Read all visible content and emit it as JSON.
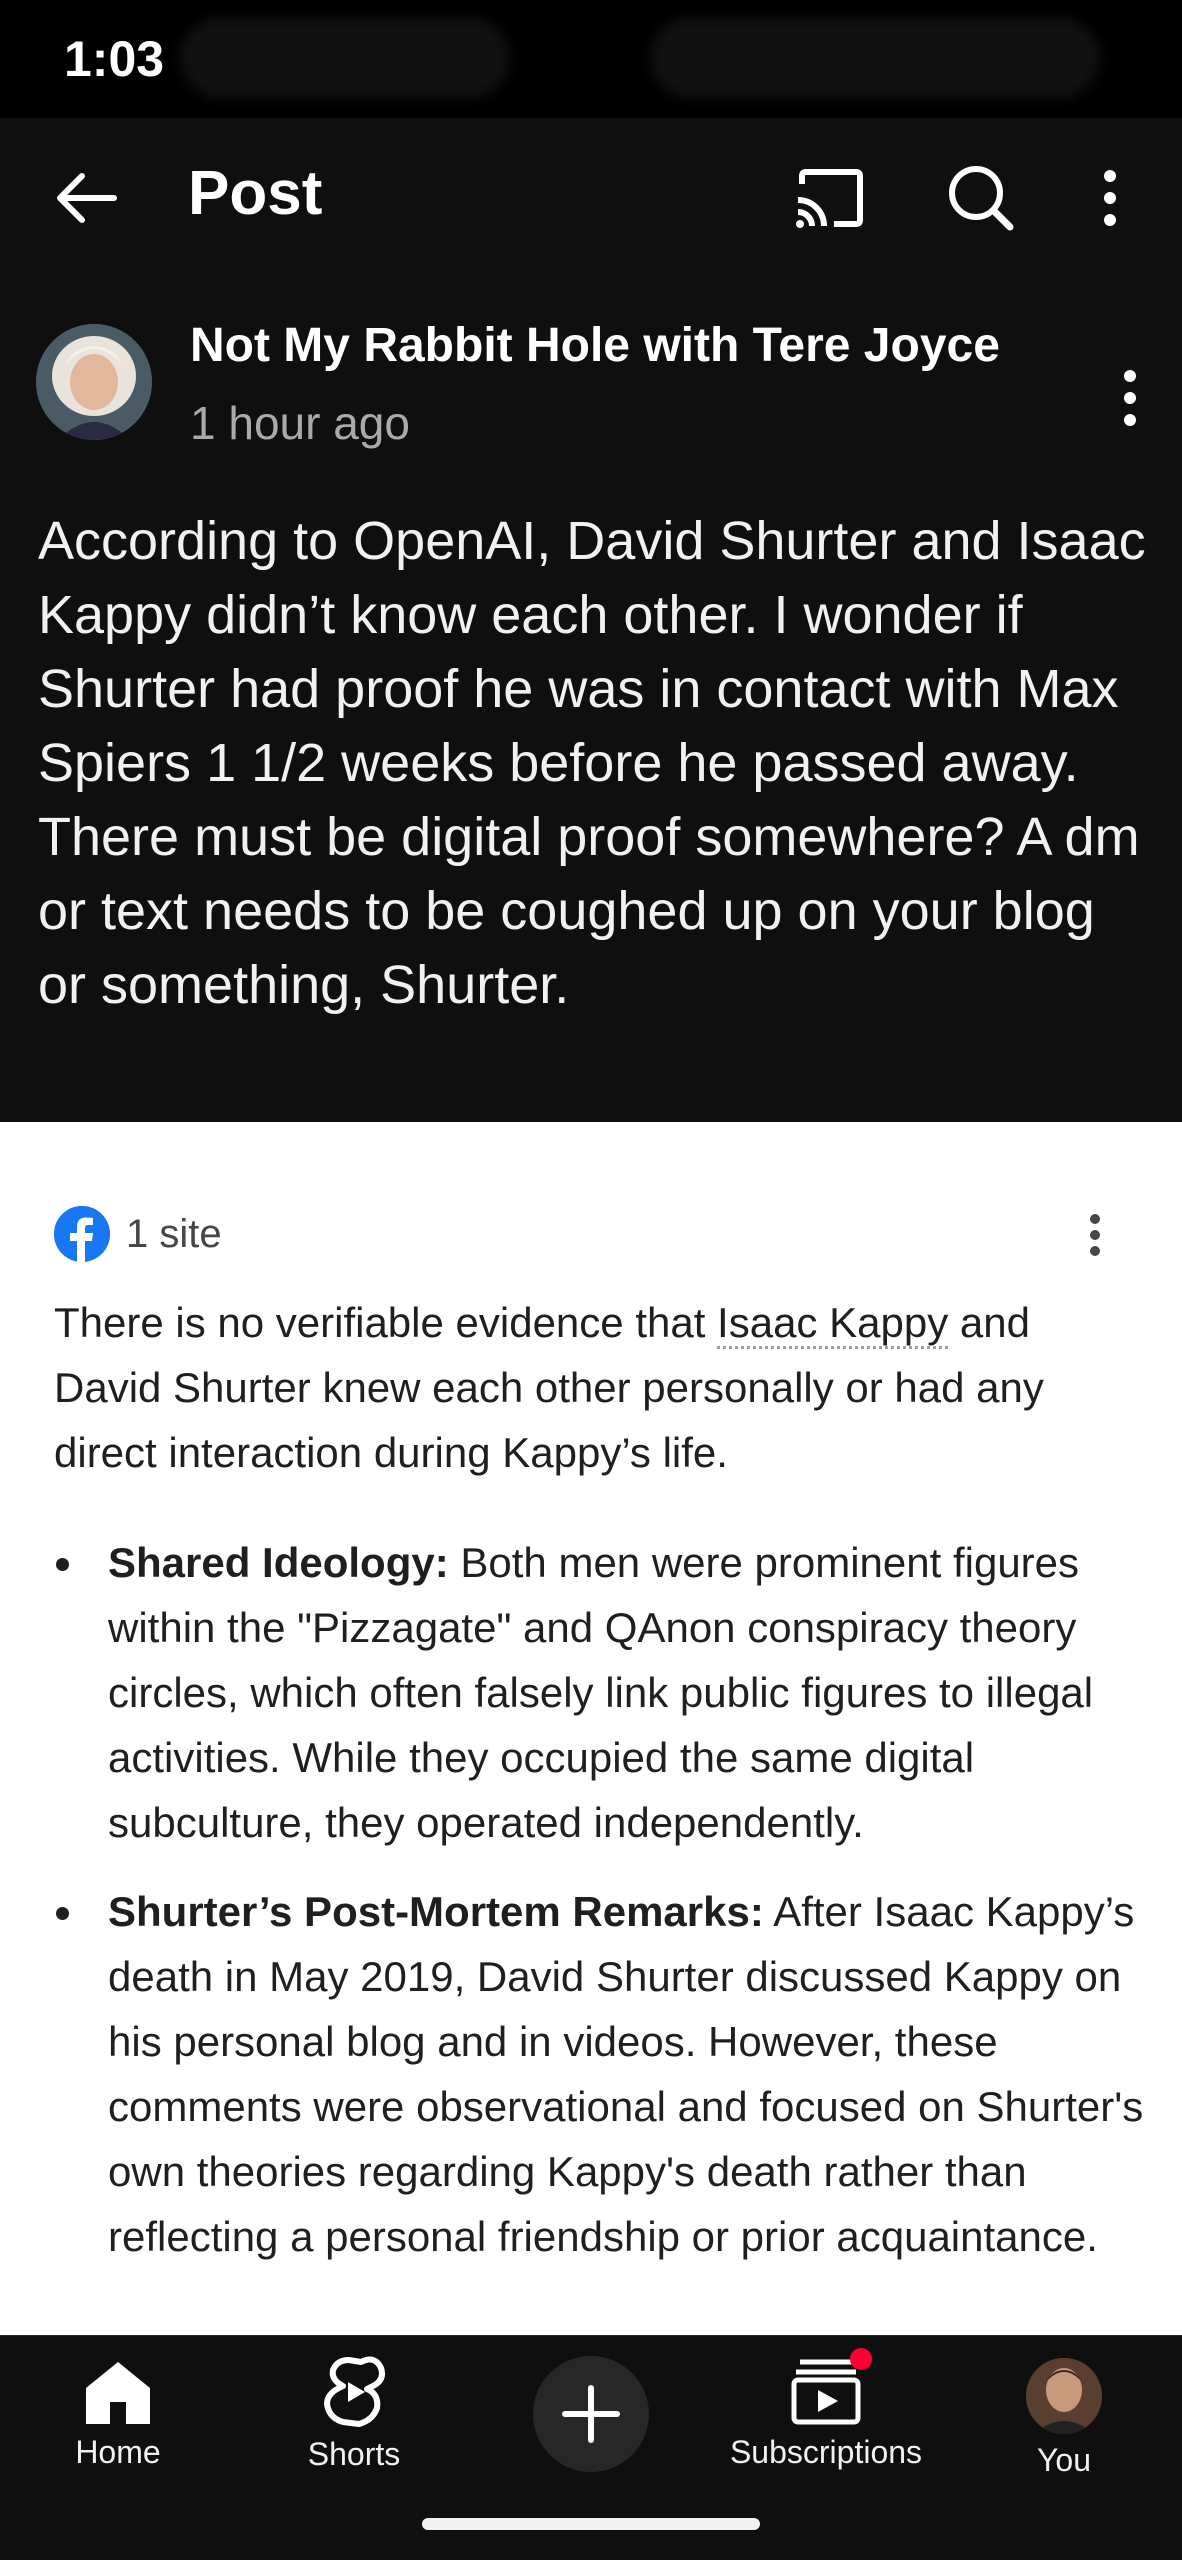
{
  "status_bar": {
    "time": "1:03"
  },
  "app_bar": {
    "title": "Post",
    "back_icon": "arrow-left-icon",
    "cast_icon": "cast-icon",
    "search_icon": "search-icon",
    "more_icon": "more-vertical-icon"
  },
  "post": {
    "channel_name": "Not My Rabbit Hole with Tere Joyce",
    "time_ago": "1 hour ago",
    "text": "According to OpenAI, David Shurter and Isaac Kappy didn’t know each other. I wonder if Shurter had proof he was in contact with Max Spiers 1 1/2 weeks before he passed away. There must be digital proof somewhere? A dm or text needs to be coughed up on your blog or something, Shurter."
  },
  "ai_card": {
    "source_icon": "facebook-icon",
    "source_label": "1 site",
    "summary_pre": "There is no verifiable evidence that ",
    "summary_link": "Isaac Kappy",
    "summary_post": " and David Shurter knew each other personally or had any direct interaction during Kappy’s life.",
    "bullets": [
      {
        "heading": "Shared Ideology:",
        "body": " Both men were prominent figures within the \"Pizzagate\" and QAnon conspiracy theory circles, which often falsely link public figures to illegal activities. While they occupied the same digital subculture, they operated independently."
      },
      {
        "heading": "Shurter’s Post-Mortem Remarks:",
        "body": " After Isaac Kappy’s death in May 2019, David Shurter discussed Kappy on his personal blog and in videos. However, these comments were observational and focused on Shurter's own theories regarding Kappy's death rather than reflecting a personal friendship or prior acquaintance."
      }
    ]
  },
  "bottom_nav": {
    "items": [
      {
        "label": "Home",
        "icon": "home-icon"
      },
      {
        "label": "Shorts",
        "icon": "shorts-icon"
      },
      {
        "label": "",
        "icon": "plus-icon"
      },
      {
        "label": "Subscriptions",
        "icon": "subscriptions-icon"
      },
      {
        "label": "You",
        "icon": "avatar"
      }
    ]
  },
  "colors": {
    "background": "#0f0f0f",
    "text": "#f1f1f1",
    "secondary_text": "#aaaaaa",
    "accent_red": "#ff0033",
    "facebook_blue": "#1877f2"
  }
}
